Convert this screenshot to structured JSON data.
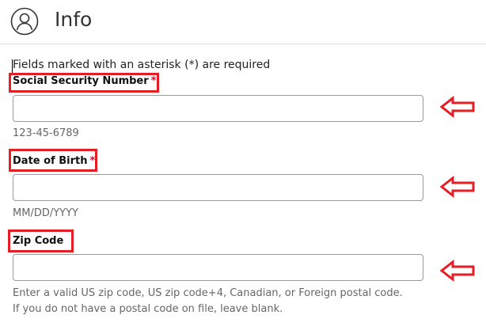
{
  "header": {
    "title": "Info",
    "icon": "user-avatar-icon"
  },
  "form": {
    "required_note": "Fields marked with an asterisk (*) are required",
    "fields": [
      {
        "label": "Social Security Number",
        "required_marker": "*",
        "value": "",
        "hint": "123-45-6789"
      },
      {
        "label": "Date of Birth",
        "required_marker": "*",
        "value": "",
        "hint": "MM/DD/YYYY"
      },
      {
        "label": "Zip Code",
        "required_marker": "",
        "value": "",
        "hint": "Enter a valid US zip code, US zip code+4, Canadian, or Foreign postal code. If you do not have a postal code on file, leave blank."
      }
    ]
  },
  "annotations": {
    "highlight_color": "#e31e24",
    "arrow_icon": "left-arrow-icon"
  }
}
